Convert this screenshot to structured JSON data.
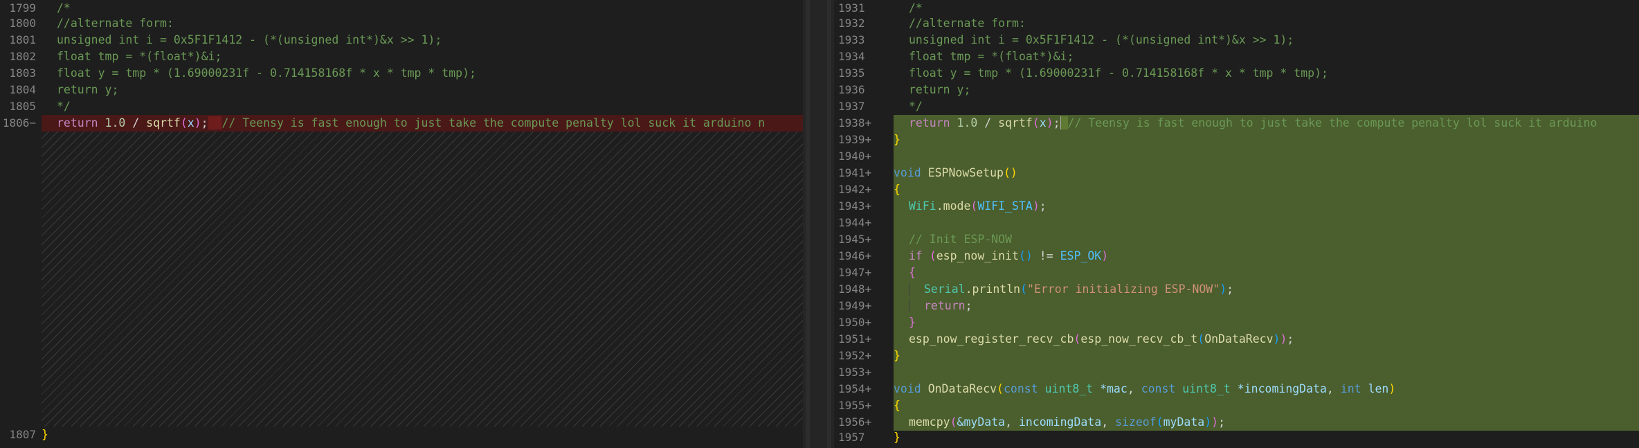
{
  "left": {
    "line_numbers": [
      "1799",
      "1800",
      "1801",
      "1802",
      "1803",
      "1804",
      "1805",
      "1806−",
      "1807"
    ],
    "lines": [
      "/*",
      "//alternate form:",
      "unsigned int i = 0x5F1F1412 - (*(unsigned int*)&x >> 1);",
      "float tmp = *(float*)&i;",
      "float y = tmp * (1.69000231f - 0.714158168f * x * tmp * tmp);",
      "return y;",
      "*/"
    ],
    "removed_line": {
      "kw": "return",
      "num": "1.0",
      "op": " / ",
      "fn": "sqrtf",
      "open": "(",
      "arg": "x",
      "close": ")",
      "semi": ";",
      "comment": "// Teensy is fast enough to just take the compute penalty lol suck it arduino n"
    },
    "closing_brace": "}"
  },
  "right": {
    "line_numbers": [
      "1931",
      "1932",
      "1933",
      "1934",
      "1935",
      "1936",
      "1937",
      "1938+",
      "1939+",
      "1940+",
      "1941+",
      "1942+",
      "1943+",
      "1944+",
      "1945+",
      "1946+",
      "1947+",
      "1948+",
      "1949+",
      "1950+",
      "1951+",
      "1952+",
      "1953+",
      "1954+",
      "1955+",
      "1956+",
      "1957"
    ],
    "context_lines": [
      "/*",
      "//alternate form:",
      "unsigned int i = 0x5F1F1412 - (*(unsigned int*)&x >> 1);",
      "float tmp = *(float*)&i;",
      "float y = tmp * (1.69000231f - 0.714158168f * x * tmp * tmp);",
      "return y;",
      "*/"
    ],
    "added_return": {
      "kw": "return",
      "num": "1.0",
      "op": " / ",
      "fn": "sqrtf",
      "open": "(",
      "arg": "x",
      "close": ")",
      "semi": ";",
      "comment": "// Teensy is fast enough to just take the compute penalty lol suck it arduino"
    },
    "brace_close": "}",
    "brace_open": "{",
    "void_kw": "void",
    "espnow_setup_fn": "ESPNowSetup",
    "parens": "()",
    "wifi_obj": "WiFi",
    "wifi_method": ".mode",
    "wifi_arg": "WIFI_STA",
    "init_comment": "// Init ESP-NOW",
    "if_kw": "if",
    "init_fn": "esp_now_init",
    "neq": " != ",
    "esp_ok": "ESP_OK",
    "serial_obj": "Serial",
    "println": ".println",
    "error_str": "\"Error initializing ESP-NOW\"",
    "return_kw": "return",
    "register_fn": "esp_now_register_recv_cb",
    "cb_type": "esp_now_recv_cb_t",
    "on_data_recv": "OnDataRecv",
    "const_kw": "const",
    "uint8_t": "uint8_t",
    "mac": "*mac",
    "incoming": "*incomingData",
    "int_kw": "int",
    "len": "len",
    "memcpy": "memcpy",
    "my_data_ref": "&myData",
    "incoming_data": "incomingData",
    "sizeof_kw": "sizeof",
    "my_data": "myData"
  }
}
